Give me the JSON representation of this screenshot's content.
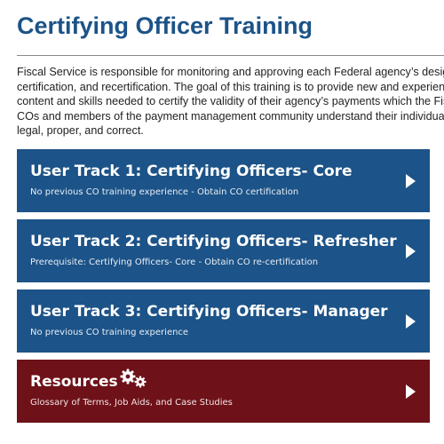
{
  "page": {
    "title": "Certifying Officer Training",
    "intro_lines": [
      "Fiscal Service is responsible for monitoring and approving each Federal agency’s designation,",
      "certification, and recertification. The goal of this training is to provide new and experienced",
      "content and skills needed to certify the validity of their agency’s payments which the Fiscal",
      "COs and members of the payment management community understand their individual",
      "legal, proper, and correct."
    ]
  },
  "tracks": [
    {
      "title": "User Track 1: Certifying Officers- Core",
      "subtitle": "No previous CO training experience - Obtain CO certification",
      "color": "#1c5388"
    },
    {
      "title": "User Track 2: Certifying Officers- Refresher",
      "subtitle": "Prerequisite: Certifying Officers- Core - Obtain CO re-certification",
      "color": "#1c5388"
    },
    {
      "title": "User Track 3: Certifying Officers- Manager",
      "subtitle": "No previous CO training experience",
      "color": "#1c5388"
    },
    {
      "title": "Resources",
      "subtitle": "Glossary of Terms, Job Aids, and Case Studies",
      "color": "#6e1119",
      "icon": "gears-icon"
    }
  ],
  "colors": {
    "heading": "#1c5388",
    "track_blue": "#1c5388",
    "track_red": "#6e1119"
  }
}
